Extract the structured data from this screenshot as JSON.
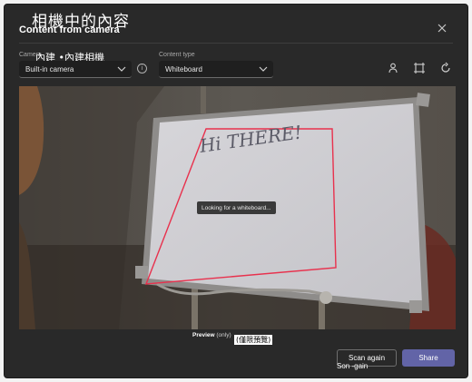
{
  "dialog": {
    "title": "Content from camera",
    "title_localized": "相機中的內容",
    "close_icon": "close-icon"
  },
  "camera": {
    "label": "Camera",
    "label_localized": "內建 •內建相機",
    "selected": "Built-in camera"
  },
  "content_type": {
    "label": "Content type",
    "selected": "Whiteboard"
  },
  "toolbar": {
    "icons": [
      "person-icon",
      "crop-icon",
      "rotate-icon"
    ]
  },
  "preview": {
    "status": "Looking for a whiteboard...",
    "whiteboard_text": "Hi THERE!",
    "note_bold": "Preview",
    "note_rest": "(only)",
    "note_localized": "(僅限預覽)"
  },
  "actions": {
    "scan_again": "Scan again",
    "scan_again_localized": "Son -gain",
    "share": "Share"
  },
  "colors": {
    "dialog_bg": "#292929",
    "accent": "#6264a7",
    "detection_outline": "#e8314d"
  }
}
